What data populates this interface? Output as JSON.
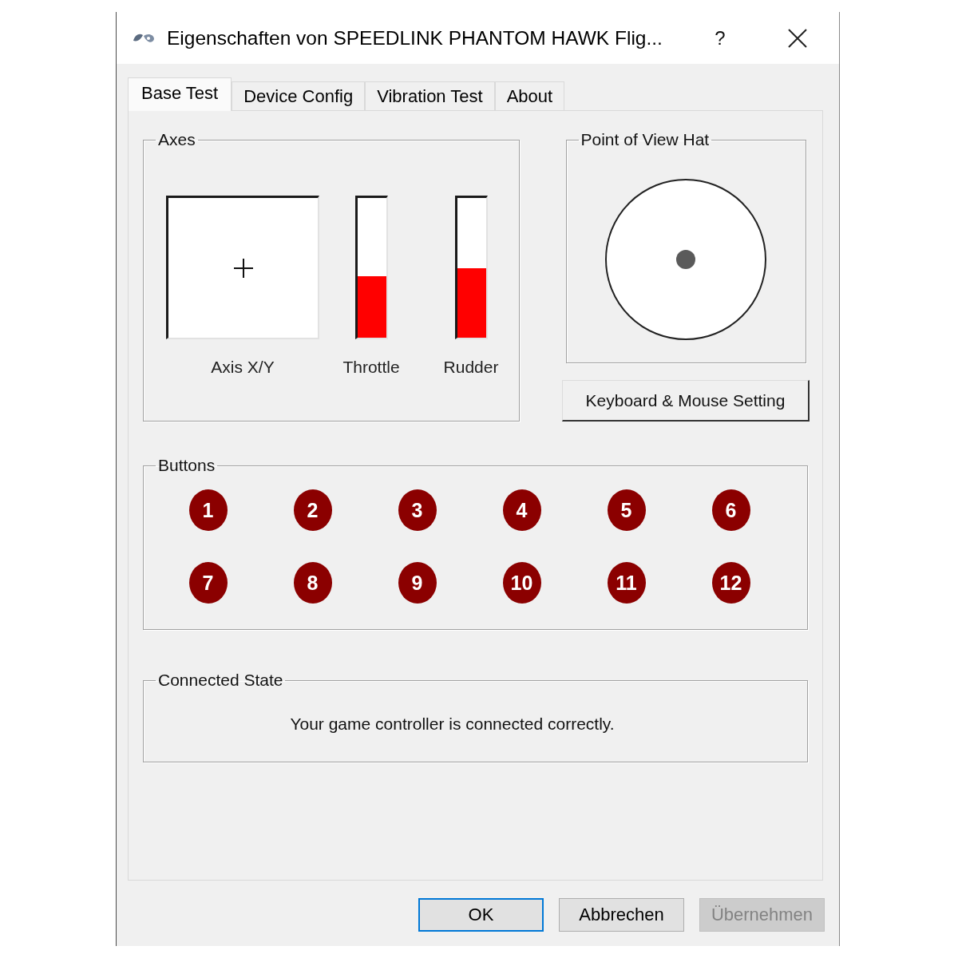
{
  "window": {
    "title": "Eigenschaften von SPEEDLINK PHANTOM HAWK Flig...",
    "help_button": "?"
  },
  "tabs": [
    {
      "label": "Base Test",
      "selected": true
    },
    {
      "label": "Device Config",
      "selected": false
    },
    {
      "label": "Vibration Test",
      "selected": false
    },
    {
      "label": "About",
      "selected": false
    }
  ],
  "axes": {
    "title": "Axes",
    "xy_label": "Axis X/Y",
    "sliders": [
      {
        "label": "Throttle",
        "level": 0.44
      },
      {
        "label": "Rudder",
        "level": 0.5
      }
    ]
  },
  "pov_hat": {
    "title": "Point of View Hat",
    "button": "Keyboard & Mouse Setting"
  },
  "buttons": {
    "title": "Buttons",
    "items": [
      "1",
      "2",
      "3",
      "4",
      "5",
      "6",
      "7",
      "8",
      "9",
      "10",
      "11",
      "12"
    ]
  },
  "connected_state": {
    "title": "Connected State",
    "message": "Your game controller is connected correctly."
  },
  "dialog_buttons": [
    {
      "label": "OK",
      "default": true,
      "disabled": false
    },
    {
      "label": "Abbrechen",
      "default": false,
      "disabled": false
    },
    {
      "label": "Übernehmen",
      "default": false,
      "disabled": true
    }
  ]
}
